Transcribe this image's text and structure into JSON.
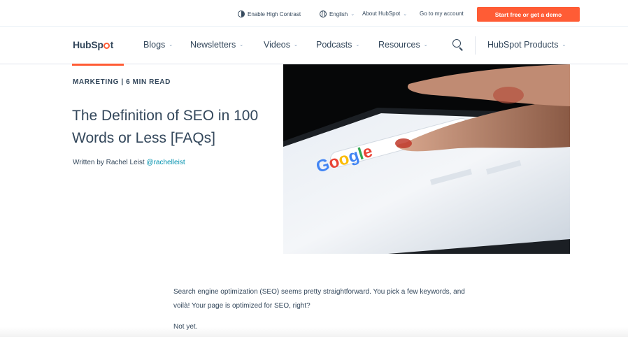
{
  "utility_bar": {
    "contrast_label": "Enable High Contrast",
    "language_label": "English",
    "about_label": "About HubSpot",
    "account_label": "Go to my account",
    "cta_label": "Start free or get a demo"
  },
  "nav": {
    "logo_text_before": "HubSp",
    "logo_text_after": "t",
    "items": [
      {
        "label": "Blogs"
      },
      {
        "label": "Newsletters"
      },
      {
        "label": "Videos"
      },
      {
        "label": "Podcasts"
      },
      {
        "label": "Resources"
      }
    ],
    "products_label": "HubSpot Products"
  },
  "article": {
    "topic": "MARKETING | 6 MIN READ",
    "title": "The Definition of SEO in 100 Words or Less [FAQs]",
    "byline_prefix": "Written by Rachel Leist",
    "byline_handle": "@rachelleist",
    "hero_image": "hand-touching-tablet-google-search",
    "paragraphs": [
      "Search engine optimization (SEO) seems pretty straightforward. You pick a few keywords, and voilà! Your page is optimized for SEO, right?",
      "Not yet."
    ]
  },
  "colors": {
    "brand_orange": "#ff5c35",
    "text_dark": "#33475b",
    "link_teal": "#0091ae"
  }
}
